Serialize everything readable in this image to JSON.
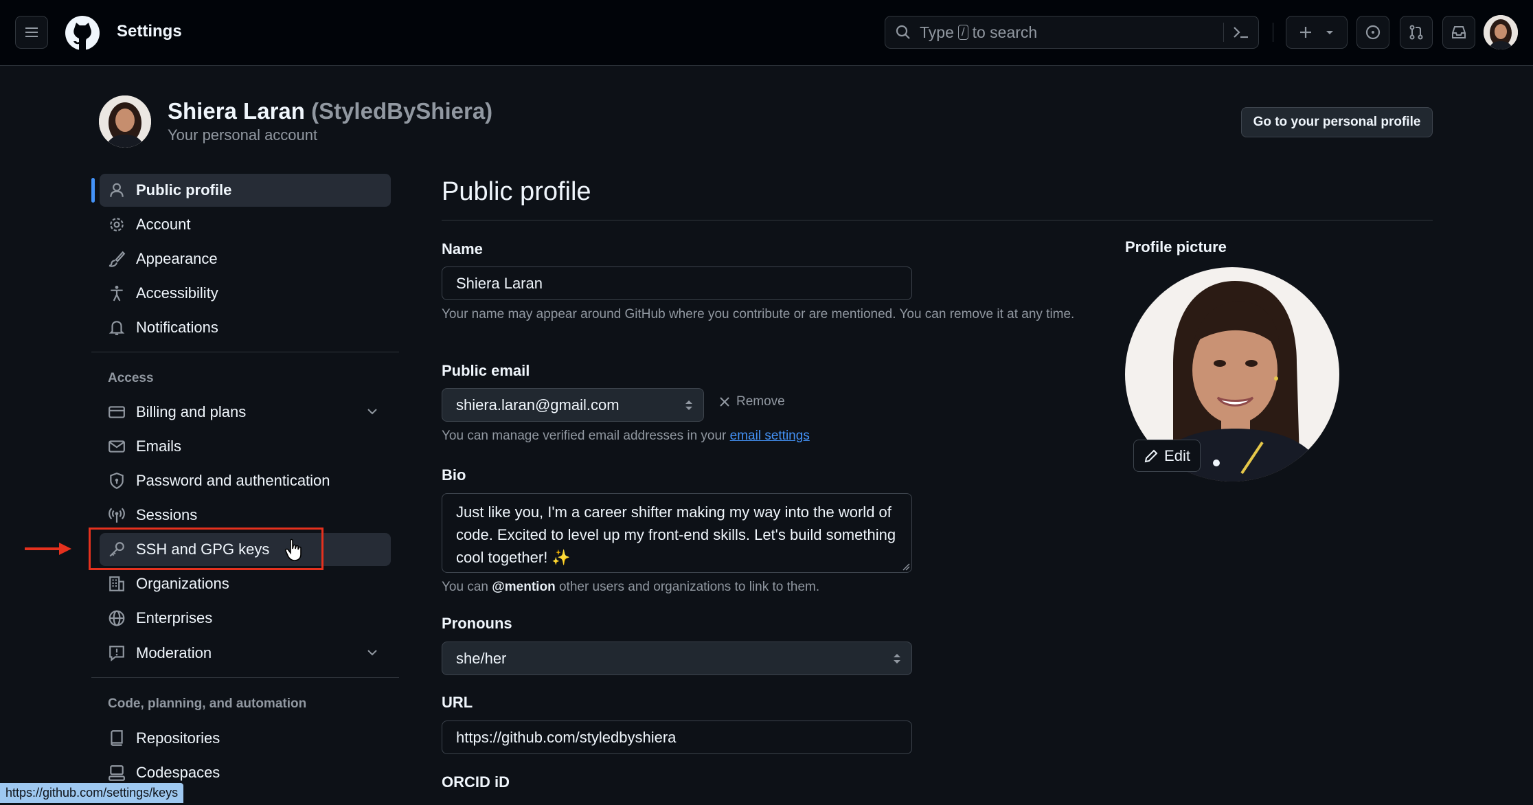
{
  "topbar": {
    "title": "Settings",
    "search_prefix": "Type",
    "search_key": "/",
    "search_suffix": "to search",
    "icons": [
      "menu-icon",
      "github-logo-icon",
      "search-icon",
      "command-palette-icon",
      "plus-icon",
      "triangle-down-icon",
      "issues-icon",
      "pull-requests-icon",
      "inbox-icon"
    ]
  },
  "header": {
    "name": "Shiera Laran",
    "handle": "(StyledByShiera)",
    "subtitle": "Your personal account",
    "goto_button": "Go to your personal profile"
  },
  "sidebar": {
    "items": [
      {
        "label": "Public profile",
        "icon": "person-icon",
        "active": true
      },
      {
        "label": "Account",
        "icon": "gear-icon"
      },
      {
        "label": "Appearance",
        "icon": "paintbrush-icon"
      },
      {
        "label": "Accessibility",
        "icon": "accessibility-icon"
      },
      {
        "label": "Notifications",
        "icon": "bell-icon"
      }
    ],
    "access_heading": "Access",
    "access_items": [
      {
        "label": "Billing and plans",
        "icon": "credit-card-icon",
        "expandable": true
      },
      {
        "label": "Emails",
        "icon": "mail-icon"
      },
      {
        "label": "Password and authentication",
        "icon": "shield-lock-icon"
      },
      {
        "label": "Sessions",
        "icon": "broadcast-icon"
      },
      {
        "label": "SSH and GPG keys",
        "icon": "key-icon",
        "hovered": true
      },
      {
        "label": "Organizations",
        "icon": "organization-icon"
      },
      {
        "label": "Enterprises",
        "icon": "globe-icon"
      },
      {
        "label": "Moderation",
        "icon": "report-icon",
        "expandable": true
      }
    ],
    "code_heading": "Code, planning, and automation",
    "code_items": [
      {
        "label": "Repositories",
        "icon": "repo-icon"
      },
      {
        "label": "Codespaces",
        "icon": "codespaces-icon"
      }
    ]
  },
  "main": {
    "title": "Public profile",
    "name_label": "Name",
    "name_value": "Shiera Laran",
    "name_hint": "Your name may appear around GitHub where you contribute or are mentioned. You can remove it at any time.",
    "email_label": "Public email",
    "email_value": "shiera.laran@gmail.com",
    "remove_label": "Remove",
    "email_hint_prefix": "You can manage verified email addresses in your",
    "email_hint_link": "email settings",
    "bio_label": "Bio",
    "bio_value": "Just like you, I'm a career shifter making my way into the world of code. Excited to level up my front-end skills. Let's build something cool together! ✨",
    "bio_hint_prefix": "You can",
    "bio_hint_mention": "@mention",
    "bio_hint_suffix": "other users and organizations to link to them.",
    "pronouns_label": "Pronouns",
    "pronouns_value": "she/her",
    "url_label": "URL",
    "url_value": "https://github.com/styledbyshiera",
    "orcid_label": "ORCID iD",
    "profile_picture_label": "Profile picture",
    "edit_label": "Edit"
  },
  "status_bar": {
    "url": "https://github.com/settings/keys"
  },
  "colors": {
    "background": "#0d1117",
    "topbar": "#010409",
    "accent": "#4493f8",
    "annotation_red": "#e5311e"
  }
}
